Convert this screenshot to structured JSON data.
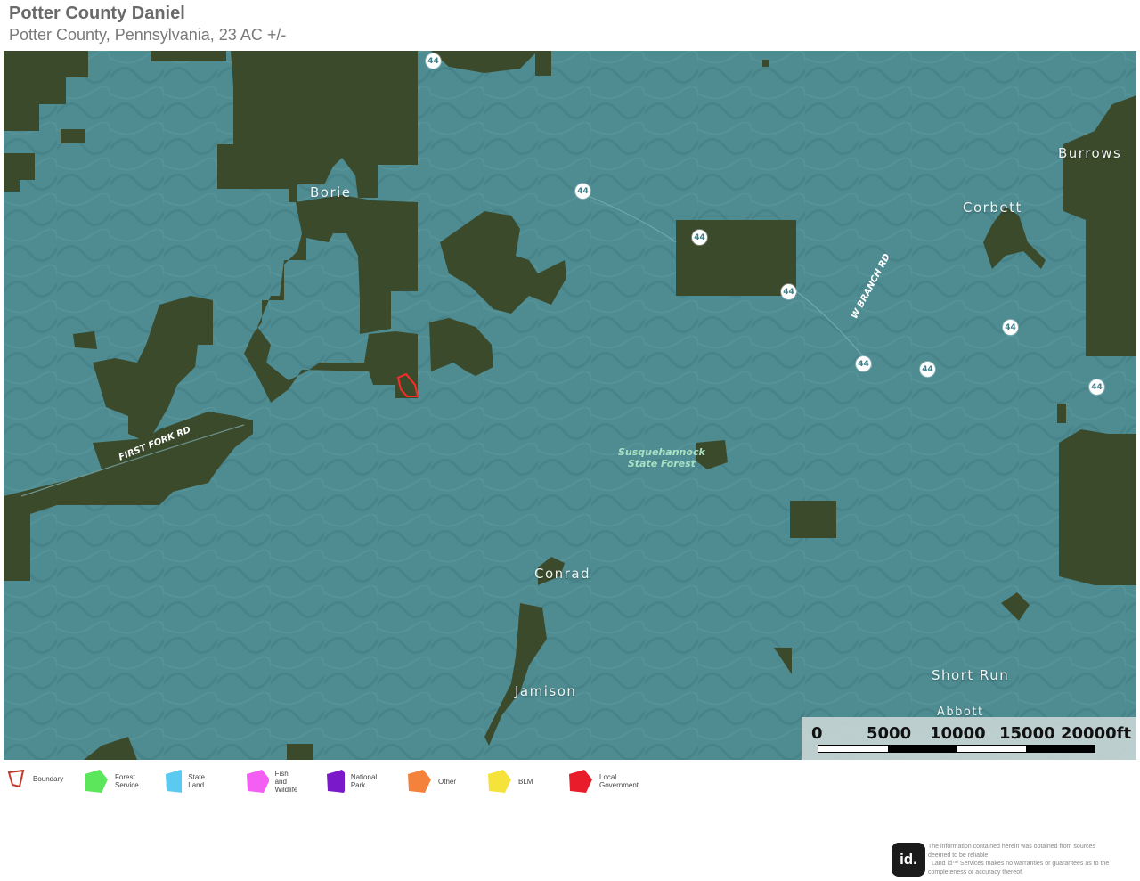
{
  "header": {
    "title": "Potter County Daniel",
    "subtitle": "Potter County, Pennsylvania, 23 AC +/-"
  },
  "map": {
    "places": {
      "borie": "Borie",
      "corbett": "Corbett",
      "burrows": "Burrows",
      "conrad": "Conrad",
      "jamison": "Jamison",
      "short_run": "Short Run",
      "abbott": "Abbott"
    },
    "roads": {
      "first_fork": "FIRST FORK RD",
      "w_branch": "W BRANCH RD"
    },
    "forest_label": [
      "Susquehannock",
      "State Forest"
    ],
    "route_shield": "44",
    "colors": {
      "state_land_overlay": "#4e8c92",
      "forest_patch": "#3c4a2c",
      "boundary": "#ff2a2a"
    }
  },
  "scale_bar": {
    "labels": [
      "0",
      "5000",
      "10000",
      "15000",
      "20000ft"
    ]
  },
  "legend": {
    "items": [
      {
        "label_1": "Boundary",
        "label_2": "",
        "color": "#ffffff",
        "stroke": "#c0392b"
      },
      {
        "label_1": "Forest",
        "label_2": "Service",
        "color": "#5be65b"
      },
      {
        "label_1": "State Land",
        "label_2": "",
        "color": "#5ccaf0"
      },
      {
        "label_1": "Fish and",
        "label_2": "Wildlife",
        "color": "#f25ff2"
      },
      {
        "label_1": "National Park",
        "label_2": "",
        "color": "#7a19c9"
      },
      {
        "label_1": "Other",
        "label_2": "",
        "color": "#f5823a"
      },
      {
        "label_1": "BLM",
        "label_2": "",
        "color": "#f5e23a"
      },
      {
        "label_1": "Local",
        "label_2": "Government",
        "color": "#e81c2a"
      }
    ]
  },
  "footer": {
    "logo_text": "id.",
    "disclaimer_1": "The information contained herein was obtained from sources",
    "disclaimer_2": "deemed to be reliable.",
    "disclaimer_3": "Land id™ Services makes no warranties or guarantees as to the",
    "disclaimer_4": "completeness or accuracy thereof."
  }
}
